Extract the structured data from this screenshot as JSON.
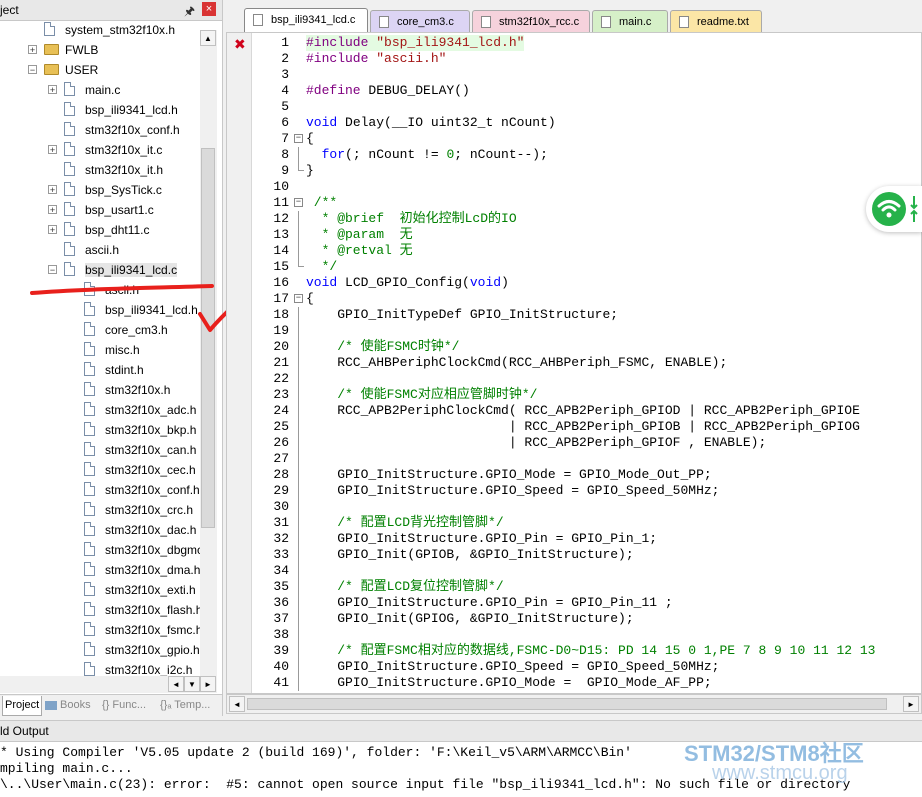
{
  "project_pane": {
    "title": "ject",
    "tree": [
      {
        "label": "system_stm32f10x.h",
        "kind": "file",
        "expander": ""
      },
      {
        "label": "FWLB",
        "kind": "folder",
        "expander": "+"
      },
      {
        "label": "USER",
        "kind": "folder",
        "expander": "-"
      },
      {
        "label": "main.c",
        "kind": "file",
        "expander": "+"
      },
      {
        "label": "bsp_ili9341_lcd.h",
        "kind": "file",
        "expander": ""
      },
      {
        "label": "stm32f10x_conf.h",
        "kind": "file",
        "expander": ""
      },
      {
        "label": "stm32f10x_it.c",
        "kind": "file",
        "expander": "+"
      },
      {
        "label": "stm32f10x_it.h",
        "kind": "file",
        "expander": ""
      },
      {
        "label": "bsp_SysTick.c",
        "kind": "file",
        "expander": "+"
      },
      {
        "label": "bsp_usart1.c",
        "kind": "file",
        "expander": "+"
      },
      {
        "label": "bsp_dht11.c",
        "kind": "file",
        "expander": "+"
      },
      {
        "label": "ascii.h",
        "kind": "file",
        "expander": ""
      },
      {
        "label": "bsp_ili9341_lcd.c",
        "kind": "file",
        "expander": "-"
      },
      {
        "label": "ascii.h",
        "kind": "file",
        "expander": ""
      },
      {
        "label": "bsp_ili9341_lcd.h",
        "kind": "file",
        "expander": ""
      },
      {
        "label": "core_cm3.h",
        "kind": "file",
        "expander": ""
      },
      {
        "label": "misc.h",
        "kind": "file",
        "expander": ""
      },
      {
        "label": "stdint.h",
        "kind": "file",
        "expander": ""
      },
      {
        "label": "stm32f10x.h",
        "kind": "file",
        "expander": ""
      },
      {
        "label": "stm32f10x_adc.h",
        "kind": "file",
        "expander": ""
      },
      {
        "label": "stm32f10x_bkp.h",
        "kind": "file",
        "expander": ""
      },
      {
        "label": "stm32f10x_can.h",
        "kind": "file",
        "expander": ""
      },
      {
        "label": "stm32f10x_cec.h",
        "kind": "file",
        "expander": ""
      },
      {
        "label": "stm32f10x_conf.h",
        "kind": "file",
        "expander": ""
      },
      {
        "label": "stm32f10x_crc.h",
        "kind": "file",
        "expander": ""
      },
      {
        "label": "stm32f10x_dac.h",
        "kind": "file",
        "expander": ""
      },
      {
        "label": "stm32f10x_dbgmc",
        "kind": "file",
        "expander": ""
      },
      {
        "label": "stm32f10x_dma.h",
        "kind": "file",
        "expander": ""
      },
      {
        "label": "stm32f10x_exti.h",
        "kind": "file",
        "expander": ""
      },
      {
        "label": "stm32f10x_flash.h",
        "kind": "file",
        "expander": ""
      },
      {
        "label": "stm32f10x_fsmc.h",
        "kind": "file",
        "expander": ""
      },
      {
        "label": "stm32f10x_gpio.h",
        "kind": "file",
        "expander": ""
      },
      {
        "label": "stm32f10x_i2c.h",
        "kind": "file",
        "expander": ""
      }
    ],
    "bottom_tabs": [
      "Project",
      "Books",
      "{} Func...",
      "{}ₐ Temp..."
    ]
  },
  "editor": {
    "tabs": [
      {
        "label": "bsp_ili9341_lcd.c",
        "color": "#ffffff",
        "active": true
      },
      {
        "label": "core_cm3.c",
        "color": "#dcd4f4",
        "active": false
      },
      {
        "label": "stm32f10x_rcc.c",
        "color": "#f6d2dc",
        "active": false
      },
      {
        "label": "main.c",
        "color": "#d6f0c8",
        "active": false
      },
      {
        "label": "readme.txt",
        "color": "#fbe6a6",
        "active": false
      }
    ],
    "error_line": 1,
    "lines": [
      {
        "n": "1",
        "fold": "",
        "hl": true,
        "parts": [
          [
            "pp",
            "#include "
          ],
          [
            "str",
            "\"bsp_ili9341_lcd.h\""
          ]
        ]
      },
      {
        "n": "2",
        "fold": "",
        "parts": [
          [
            "pp",
            "#include "
          ],
          [
            "str",
            "\"ascii.h\""
          ]
        ]
      },
      {
        "n": "3",
        "fold": "",
        "parts": []
      },
      {
        "n": "4",
        "fold": "",
        "parts": [
          [
            "pp",
            "#define "
          ],
          [
            "t",
            "DEBUG_DELAY()"
          ]
        ]
      },
      {
        "n": "5",
        "fold": "",
        "parts": []
      },
      {
        "n": "6",
        "fold": "",
        "parts": [
          [
            "kw",
            "void "
          ],
          [
            "t",
            "Delay(__IO uint32_t nCount)"
          ]
        ]
      },
      {
        "n": "7",
        "fold": "box",
        "parts": [
          [
            "t",
            "{"
          ]
        ]
      },
      {
        "n": "8",
        "fold": "vl",
        "parts": [
          [
            "t",
            "  "
          ],
          [
            "kw",
            "for"
          ],
          [
            "t",
            "(; nCount != "
          ],
          [
            "num2",
            "0"
          ],
          [
            "t",
            "; nCount--);"
          ]
        ]
      },
      {
        "n": "9",
        "fold": "end",
        "parts": [
          [
            "t",
            "}"
          ]
        ]
      },
      {
        "n": "10",
        "fold": "",
        "parts": []
      },
      {
        "n": "11",
        "fold": "box",
        "parts": [
          [
            "cm",
            " /**"
          ]
        ]
      },
      {
        "n": "12",
        "fold": "vl",
        "parts": [
          [
            "cm",
            "  * @brief  初始化控制LcD的IO"
          ]
        ]
      },
      {
        "n": "13",
        "fold": "vl",
        "parts": [
          [
            "cm",
            "  * @param  无"
          ]
        ]
      },
      {
        "n": "14",
        "fold": "vl",
        "parts": [
          [
            "cm",
            "  * @retval 无"
          ]
        ]
      },
      {
        "n": "15",
        "fold": "end",
        "parts": [
          [
            "cm",
            "  */"
          ]
        ]
      },
      {
        "n": "16",
        "fold": "",
        "parts": [
          [
            "kw",
            "void "
          ],
          [
            "t",
            "LCD_GPIO_Config("
          ],
          [
            "kw",
            "void"
          ],
          [
            "t",
            ")"
          ]
        ]
      },
      {
        "n": "17",
        "fold": "box",
        "parts": [
          [
            "t",
            "{"
          ]
        ]
      },
      {
        "n": "18",
        "fold": "vl",
        "parts": [
          [
            "t",
            "    GPIO_InitTypeDef GPIO_InitStructure;"
          ]
        ]
      },
      {
        "n": "19",
        "fold": "vl",
        "parts": []
      },
      {
        "n": "20",
        "fold": "vl",
        "parts": [
          [
            "cm",
            "    /* 使能FSMC时钟*/"
          ]
        ]
      },
      {
        "n": "21",
        "fold": "vl",
        "parts": [
          [
            "t",
            "    RCC_AHBPeriphClockCmd(RCC_AHBPeriph_FSMC, ENABLE);"
          ]
        ]
      },
      {
        "n": "22",
        "fold": "vl",
        "parts": []
      },
      {
        "n": "23",
        "fold": "vl",
        "parts": [
          [
            "cm",
            "    /* 使能FSMC对应相应管脚时钟*/"
          ]
        ]
      },
      {
        "n": "24",
        "fold": "vl",
        "parts": [
          [
            "t",
            "    RCC_APB2PeriphClockCmd( RCC_APB2Periph_GPIOD | RCC_APB2Periph_GPIOE"
          ]
        ]
      },
      {
        "n": "25",
        "fold": "vl",
        "parts": [
          [
            "t",
            "                          | RCC_APB2Periph_GPIOB | RCC_APB2Periph_GPIOG"
          ]
        ]
      },
      {
        "n": "26",
        "fold": "vl",
        "parts": [
          [
            "t",
            "                          | RCC_APB2Periph_GPIOF , ENABLE);"
          ]
        ]
      },
      {
        "n": "27",
        "fold": "vl",
        "parts": []
      },
      {
        "n": "28",
        "fold": "vl",
        "parts": [
          [
            "t",
            "    GPIO_InitStructure.GPIO_Mode = GPIO_Mode_Out_PP;"
          ]
        ]
      },
      {
        "n": "29",
        "fold": "vl",
        "parts": [
          [
            "t",
            "    GPIO_InitStructure.GPIO_Speed = GPIO_Speed_50MHz;"
          ]
        ]
      },
      {
        "n": "30",
        "fold": "vl",
        "parts": []
      },
      {
        "n": "31",
        "fold": "vl",
        "parts": [
          [
            "cm",
            "    /* 配置LCD背光控制管脚*/"
          ]
        ]
      },
      {
        "n": "32",
        "fold": "vl",
        "parts": [
          [
            "t",
            "    GPIO_InitStructure.GPIO_Pin = GPIO_Pin_1;"
          ]
        ]
      },
      {
        "n": "33",
        "fold": "vl",
        "parts": [
          [
            "t",
            "    GPIO_Init(GPIOB, &GPIO_InitStructure);"
          ]
        ]
      },
      {
        "n": "34",
        "fold": "vl",
        "parts": []
      },
      {
        "n": "35",
        "fold": "vl",
        "parts": [
          [
            "cm",
            "    /* 配置LCD复位控制管脚*/"
          ]
        ]
      },
      {
        "n": "36",
        "fold": "vl",
        "parts": [
          [
            "t",
            "    GPIO_InitStructure.GPIO_Pin = GPIO_Pin_11 ;"
          ]
        ]
      },
      {
        "n": "37",
        "fold": "vl",
        "parts": [
          [
            "t",
            "    GPIO_Init(GPIOG, &GPIO_InitStructure);"
          ]
        ]
      },
      {
        "n": "38",
        "fold": "vl",
        "parts": []
      },
      {
        "n": "39",
        "fold": "vl",
        "parts": [
          [
            "cm",
            "    /* 配置FSMC相对应的数据线,FSMC-D0~D15: PD 14 15 0 1,PE 7 8 9 10 11 12 13"
          ]
        ]
      },
      {
        "n": "40",
        "fold": "vl",
        "parts": [
          [
            "t",
            "    GPIO_InitStructure.GPIO_Speed = GPIO_Speed_50MHz;"
          ]
        ]
      },
      {
        "n": "41",
        "fold": "vl",
        "parts": [
          [
            "t",
            "    GPIO_InitStructure.GPIO_Mode =  GPIO_Mode_AF_PP;"
          ]
        ]
      }
    ]
  },
  "build_output": {
    "title": "ld Output",
    "lines": [
      "* Using Compiler 'V5.05 update 2 (build 169)', folder: 'F:\\Keil_v5\\ARM\\ARMCC\\Bin'",
      "mpiling main.c...",
      "\\..\\User\\main.c(23): error:  #5: cannot open source input file \"bsp_ili9341_lcd.h\": No such file or directory"
    ]
  },
  "watermark": {
    "line1": "STM32/STM8社区",
    "line2": "www.stmcu.org"
  },
  "colors": {
    "annotation_red": "#e8201c",
    "comment_green": "#008000",
    "keyword_blue": "#0000ff",
    "preproc_purple": "#800080",
    "string_red": "#a31515",
    "error_red": "#d0021b",
    "wifi_green": "#26b24a"
  },
  "icons": [
    "pin-icon",
    "close-icon",
    "error-mark-icon",
    "wifi-icon",
    "folder-icon",
    "file-icon"
  ]
}
